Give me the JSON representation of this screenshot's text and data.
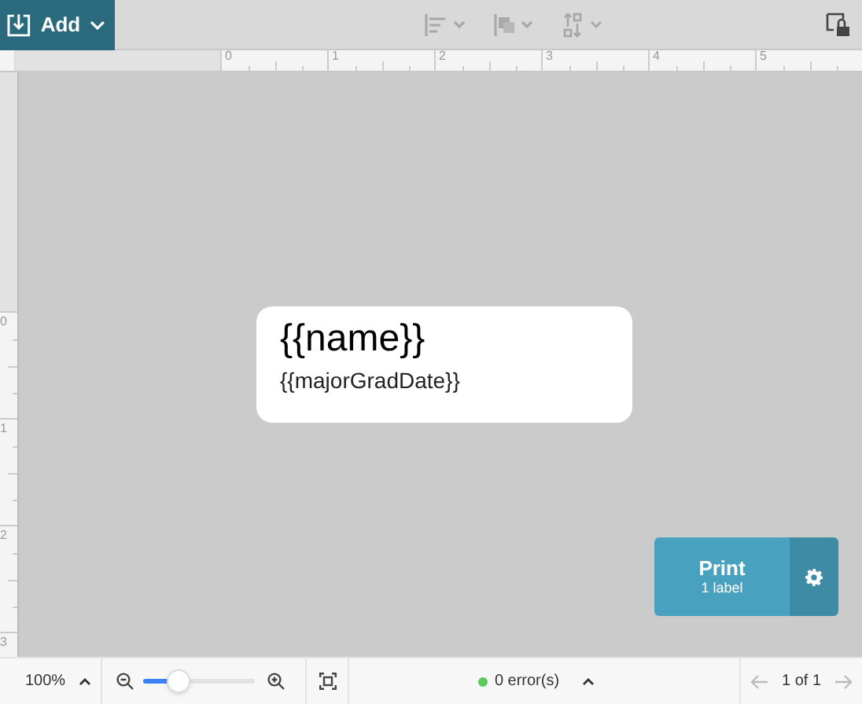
{
  "toolbar": {
    "add_button": "Add"
  },
  "ruler": {
    "horizontal": [
      "0",
      "1",
      "2",
      "3",
      "4",
      "5"
    ],
    "vertical": [
      "0",
      "1",
      "2",
      "3"
    ]
  },
  "label": {
    "lines": [
      "{{name}}",
      "{{majorGradDate}}"
    ]
  },
  "print_button": {
    "title": "Print",
    "subtitle": "1 label"
  },
  "status_bar": {
    "zoom": "100%",
    "zoom_level": {
      "level": 0.27
    },
    "errors": {
      "text": "0 error(s)",
      "color": "#5ac85a"
    },
    "page": "1 of 1"
  }
}
